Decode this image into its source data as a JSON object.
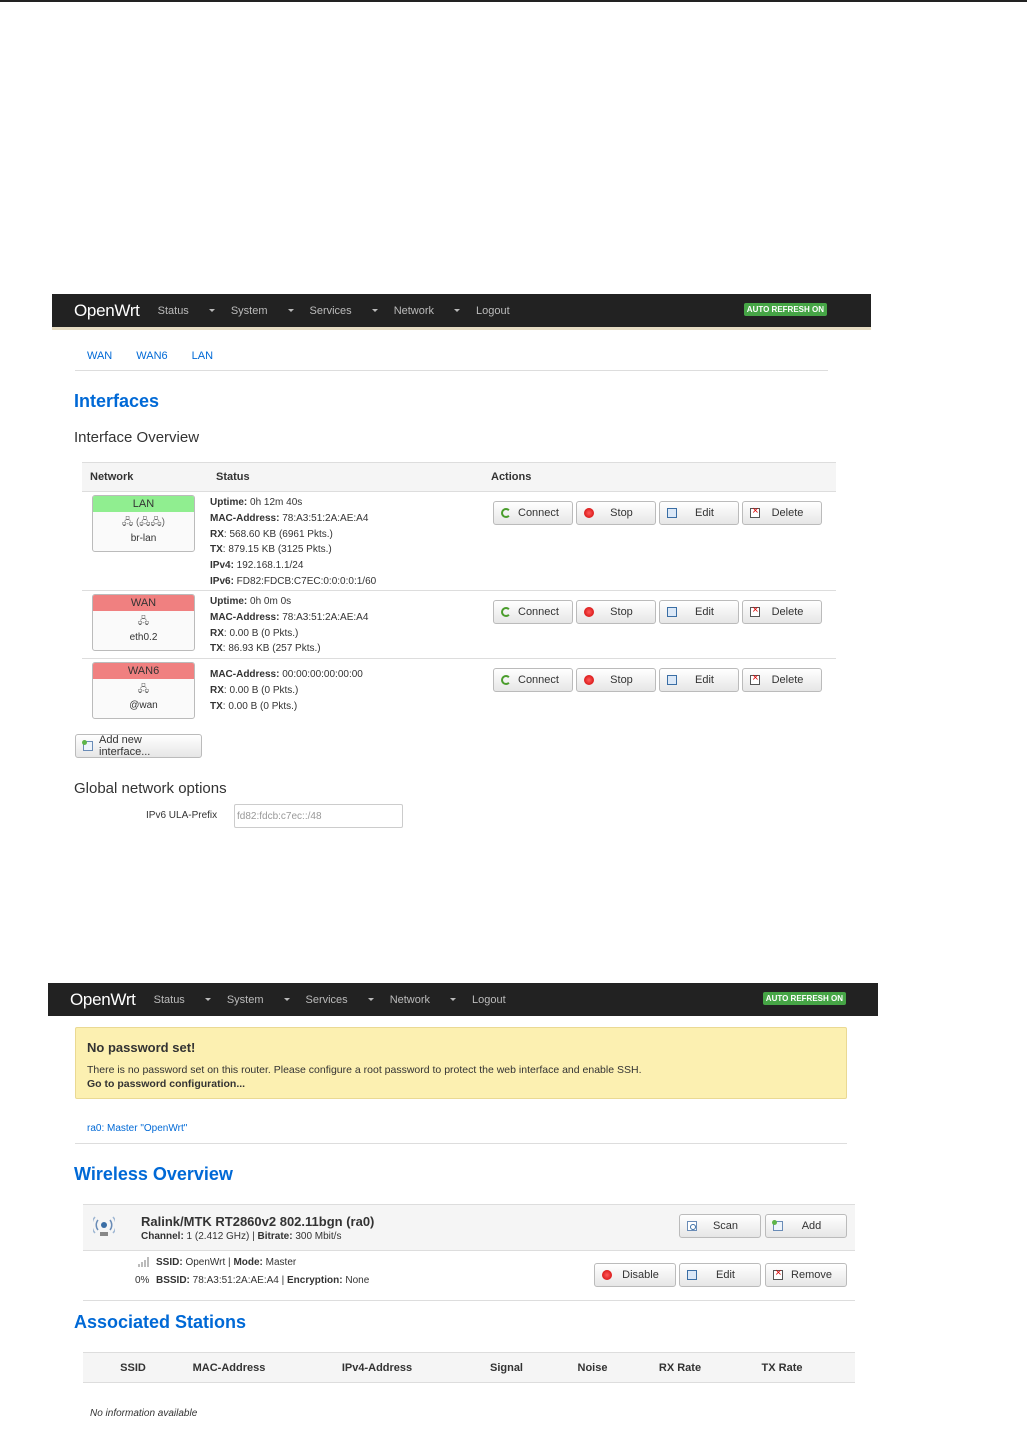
{
  "brand": "OpenWrt",
  "menu": [
    "Status",
    "System",
    "Services",
    "Network",
    "Logout"
  ],
  "auto_refresh": "AUTO REFRESH ON",
  "interfaces_page": {
    "tabs": [
      "WAN",
      "WAN6",
      "LAN"
    ],
    "title": "Interfaces",
    "subtitle": "Interface Overview",
    "columns": {
      "network": "Network",
      "status": "Status",
      "actions": "Actions"
    },
    "rows": [
      {
        "name": "LAN",
        "color": "#90ee90",
        "glyph": "🖧 (🖧🖧)",
        "device": "br-lan",
        "status": [
          {
            "k": "Uptime:",
            "v": " 0h 12m 40s"
          },
          {
            "k": "MAC-Address:",
            "v": " 78:A3:51:2A:AE:A4"
          },
          {
            "k": "RX",
            "v": ": 568.60 KB (6961 Pkts.)"
          },
          {
            "k": "TX",
            "v": ": 879.15 KB (3125 Pkts.)"
          },
          {
            "k": "IPv4:",
            "v": " 192.168.1.1/24"
          },
          {
            "k": "IPv6:",
            "v": " FD82:FDCB:C7EC:0:0:0:0:1/60"
          }
        ]
      },
      {
        "name": "WAN",
        "color": "#f08080",
        "glyph": "🖧",
        "device": "eth0.2",
        "status": [
          {
            "k": "Uptime:",
            "v": " 0h 0m 0s"
          },
          {
            "k": "MAC-Address:",
            "v": " 78:A3:51:2A:AE:A4"
          },
          {
            "k": "RX",
            "v": ": 0.00 B (0 Pkts.)"
          },
          {
            "k": "TX",
            "v": ": 86.93 KB (257 Pkts.)"
          }
        ]
      },
      {
        "name": "WAN6",
        "color": "#f08080",
        "glyph": "🖧",
        "device": "@wan",
        "status": [
          {
            "k": "MAC-Address:",
            "v": " 00:00:00:00:00:00"
          },
          {
            "k": "RX",
            "v": ": 0.00 B (0 Pkts.)"
          },
          {
            "k": "TX",
            "v": ": 0.00 B (0 Pkts.)"
          }
        ]
      }
    ],
    "actions": [
      "Connect",
      "Stop",
      "Edit",
      "Delete"
    ],
    "add_button": "Add new interface...",
    "global_title": "Global network options",
    "ula_label": "IPv6 ULA-Prefix",
    "ula_value": "fd82:fdcb:c7ec::/48"
  },
  "wireless_page": {
    "alert_title": "No password set!",
    "alert_text": "There is no password set on this router. Please configure a root password to protect the web interface and enable SSH.",
    "alert_link": "Go to password configuration...",
    "tab": "ra0: Master \"OpenWrt\"",
    "title": "Wireless Overview",
    "device_name": "Ralink/MTK RT2860v2 802.11bgn (ra0)",
    "channel_label": "Channel:",
    "channel_value": " 1 (2.412 GHz) | ",
    "bitrate_label": "Bitrate:",
    "bitrate_value": " 300 Mbit/s",
    "scan": "Scan",
    "add": "Add",
    "signal_pct": "0%",
    "ssid_label": "SSID:",
    "ssid_value": " OpenWrt | ",
    "mode_label": "Mode:",
    "mode_value": " Master",
    "bssid_label": "BSSID:",
    "bssid_value": " 78:A3:51:2A:AE:A4 | ",
    "enc_label": "Encryption:",
    "enc_value": " None",
    "disable": "Disable",
    "edit": "Edit",
    "remove": "Remove",
    "stations_title": "Associated Stations",
    "stations_cols": [
      "SSID",
      "MAC-Address",
      "IPv4-Address",
      "Signal",
      "Noise",
      "RX Rate",
      "TX Rate"
    ],
    "no_info": "No information available"
  }
}
